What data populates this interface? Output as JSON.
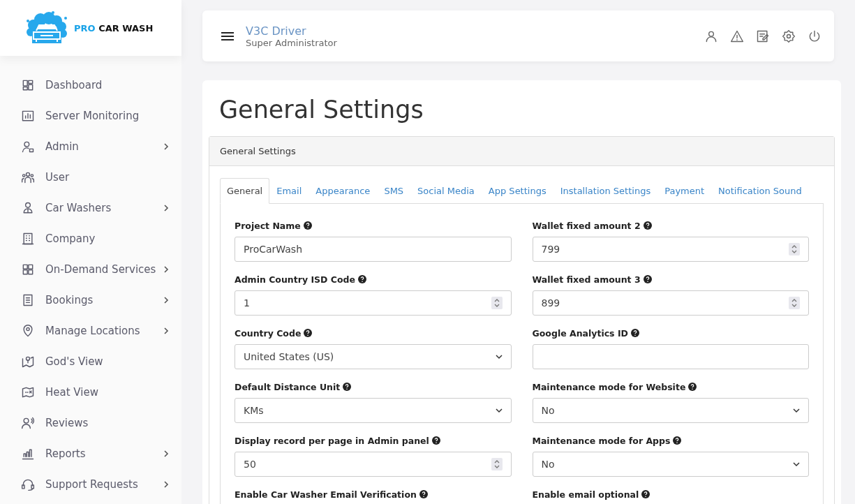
{
  "logo": {
    "accent": "PRO",
    "name": "CAR WASH"
  },
  "sidebar": {
    "items": [
      {
        "label": "Dashboard",
        "expandable": false
      },
      {
        "label": "Server Monitoring",
        "expandable": false
      },
      {
        "label": "Admin",
        "expandable": true
      },
      {
        "label": "User",
        "expandable": false
      },
      {
        "label": "Car Washers",
        "expandable": true
      },
      {
        "label": "Company",
        "expandable": false
      },
      {
        "label": "On-Demand Services",
        "expandable": true
      },
      {
        "label": "Bookings",
        "expandable": true
      },
      {
        "label": "Manage Locations",
        "expandable": true
      },
      {
        "label": "God's View",
        "expandable": false
      },
      {
        "label": "Heat View",
        "expandable": false
      },
      {
        "label": "Reviews",
        "expandable": false
      },
      {
        "label": "Reports",
        "expandable": true
      },
      {
        "label": "Support Requests",
        "expandable": true
      }
    ]
  },
  "header": {
    "user_name": "V3C Driver",
    "role": "Super Administrator"
  },
  "page_title": "General Settings",
  "panel": {
    "title": "General Settings"
  },
  "tabs": [
    {
      "label": "General",
      "selected": true
    },
    {
      "label": "Email",
      "selected": false
    },
    {
      "label": "Appearance",
      "selected": false
    },
    {
      "label": "SMS",
      "selected": false
    },
    {
      "label": "Social Media",
      "selected": false
    },
    {
      "label": "App Settings",
      "selected": false
    },
    {
      "label": "Installation Settings",
      "selected": false
    },
    {
      "label": "Payment",
      "selected": false
    },
    {
      "label": "Notification Sound",
      "selected": false
    }
  ],
  "fields": [
    {
      "label": "Project Name",
      "kind": "text",
      "value": "ProCarWash"
    },
    {
      "label": "Wallet fixed amount 2",
      "kind": "number",
      "value": "799"
    },
    {
      "label": "Admin Country ISD Code",
      "kind": "number",
      "value": "1"
    },
    {
      "label": "Wallet fixed amount 3",
      "kind": "number",
      "value": "899"
    },
    {
      "label": "Country Code",
      "kind": "select",
      "value": "United States (US)"
    },
    {
      "label": "Google Analytics ID",
      "kind": "text"
    },
    {
      "label": "Default Distance Unit",
      "kind": "select",
      "value": "KMs"
    },
    {
      "label": "Maintenance mode for Website",
      "kind": "select",
      "value": "No"
    },
    {
      "label": "Display record per page in Admin panel",
      "kind": "number",
      "value": "50"
    },
    {
      "label": "Maintenance mode for Apps",
      "kind": "select",
      "value": "No"
    },
    {
      "label": "Enable Car Washer Email Verification",
      "kind": "label"
    },
    {
      "label": "Enable email optional",
      "kind": "label"
    }
  ]
}
